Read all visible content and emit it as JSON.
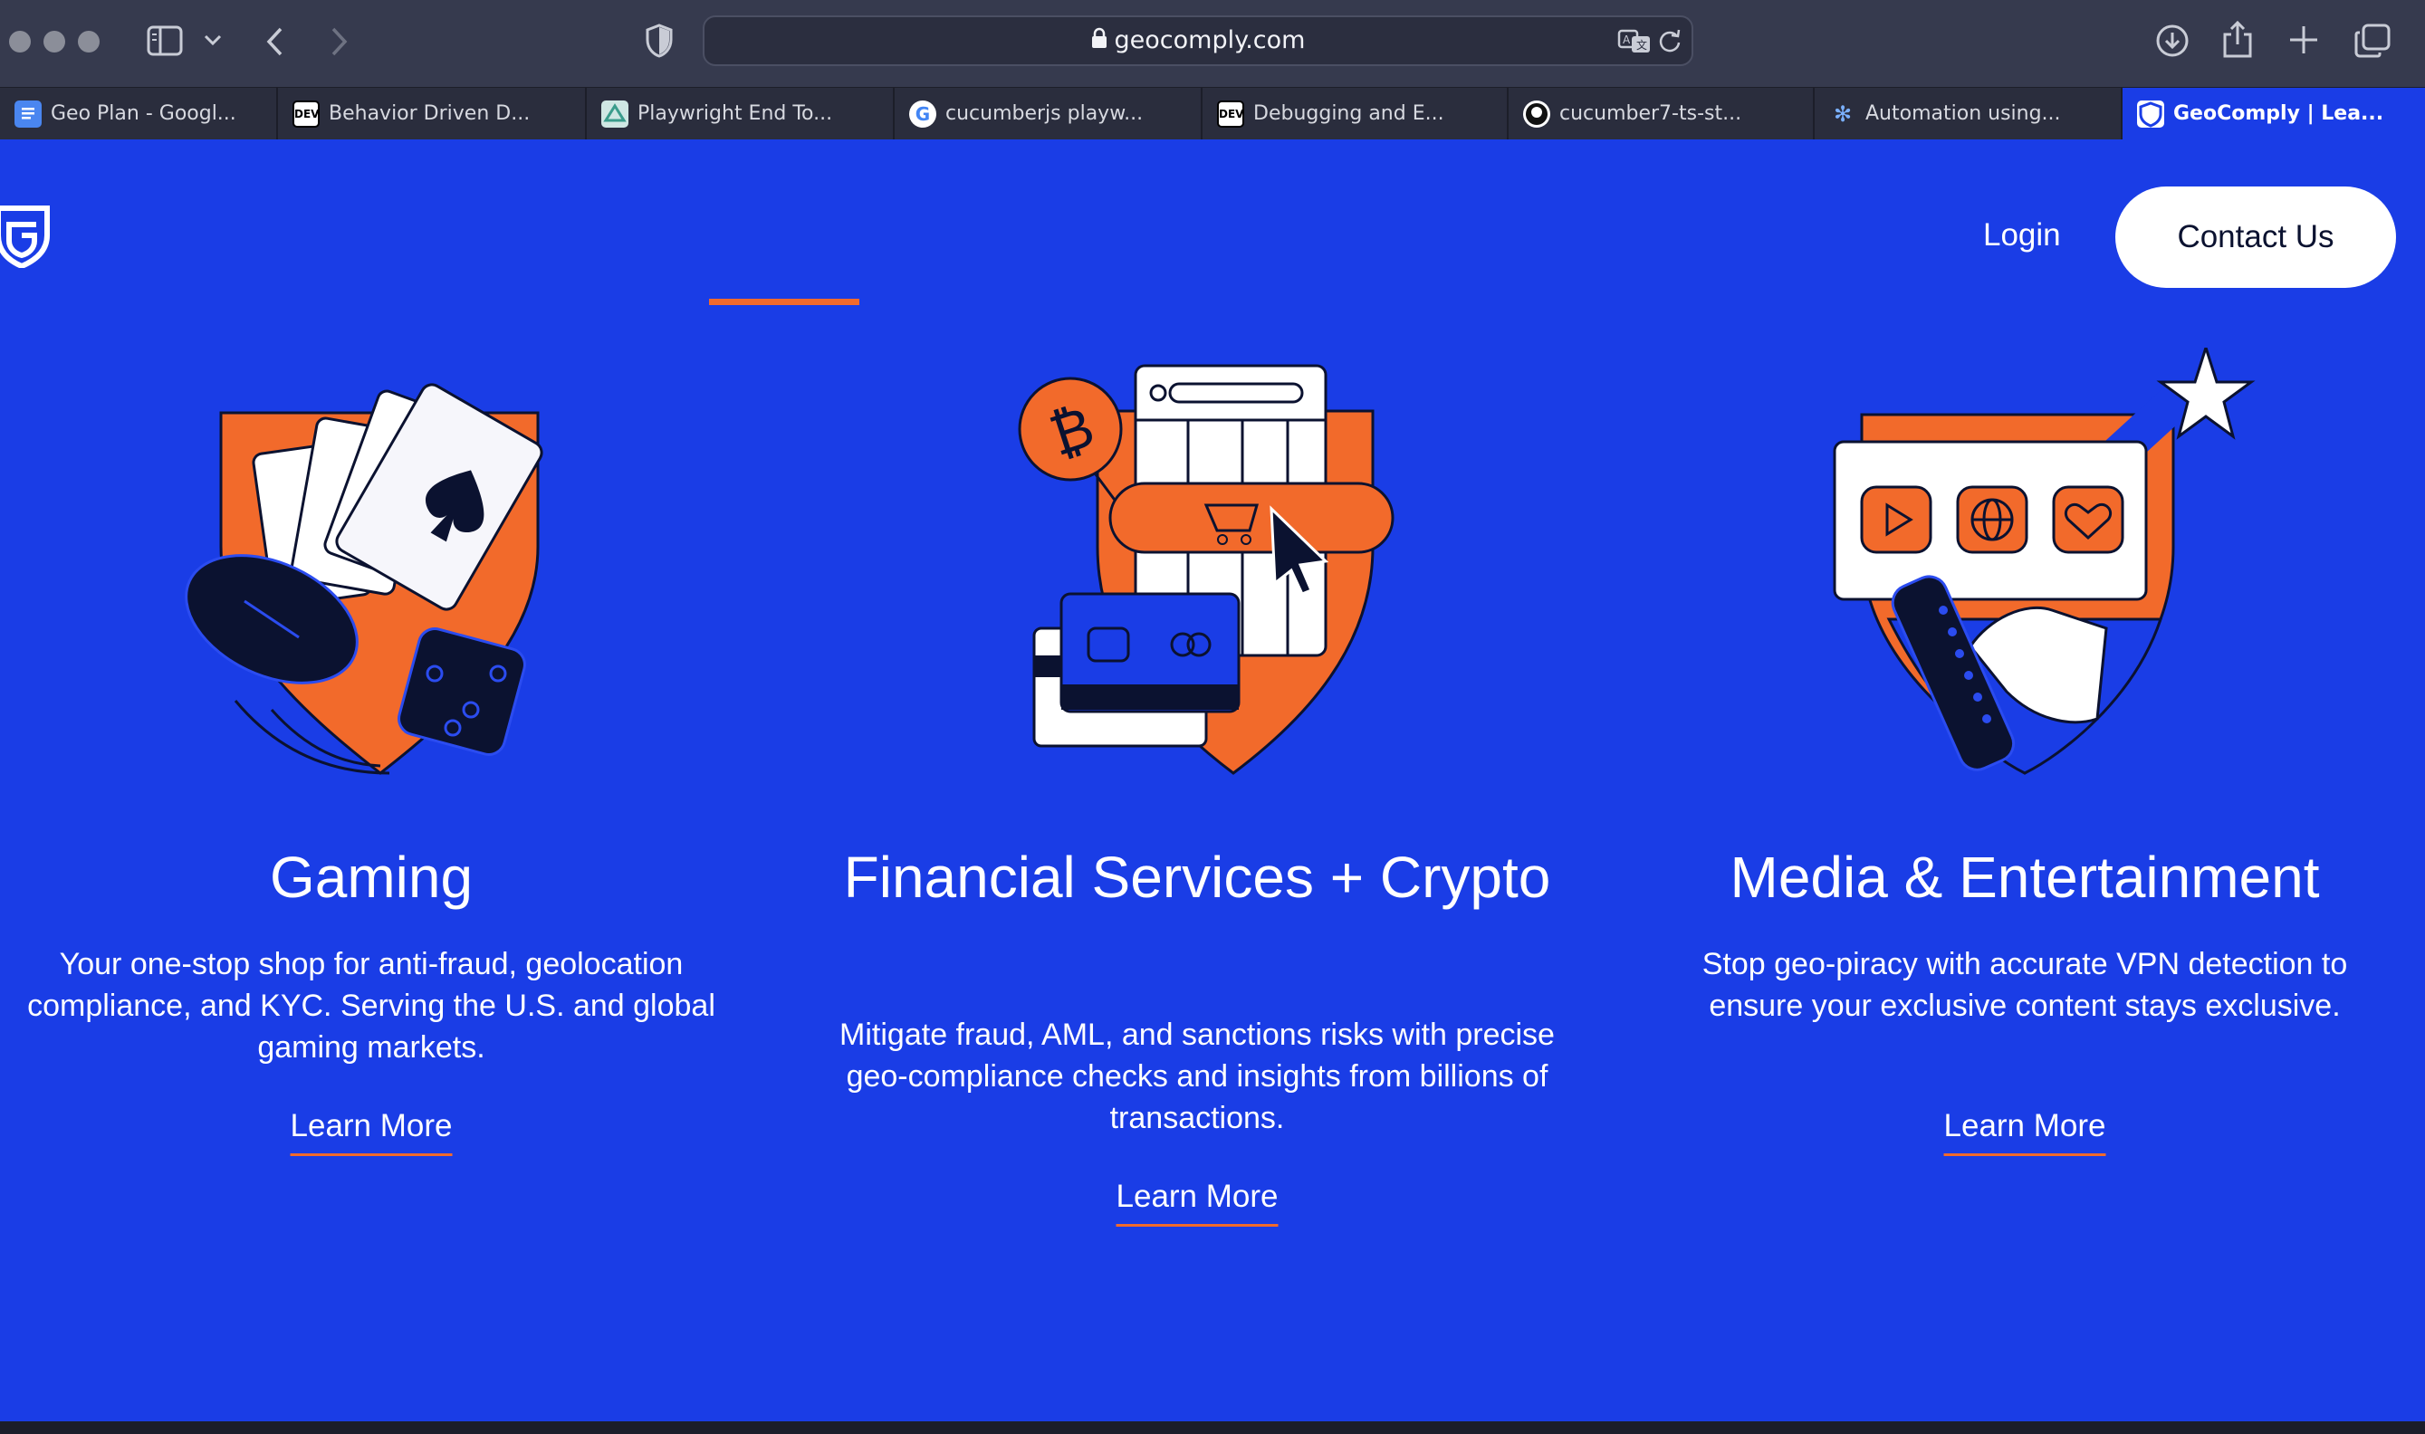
{
  "browser": {
    "url": "geocomply.com",
    "tabs": [
      {
        "label": "Geo Plan - Googl...",
        "icon": "google-docs-icon",
        "active": false
      },
      {
        "label": "Behavior Driven D...",
        "icon": "dev-icon",
        "active": false
      },
      {
        "label": "Playwright End To...",
        "icon": "site-icon",
        "active": false
      },
      {
        "label": "cucumberjs playw...",
        "icon": "google-icon",
        "active": false
      },
      {
        "label": "Debugging and E...",
        "icon": "dev-icon",
        "active": false
      },
      {
        "label": "cucumber7-ts-st...",
        "icon": "github-icon",
        "active": false
      },
      {
        "label": "Automation using...",
        "icon": "sparkle-icon",
        "active": false
      },
      {
        "label": "GeoComply | Lea...",
        "icon": "geocomply-icon",
        "active": true
      }
    ]
  },
  "header": {
    "login_label": "Login",
    "contact_label": "Contact Us"
  },
  "columns": [
    {
      "title": "Gaming",
      "description": "Your one-stop shop for anti-fraud, geolocation compliance, and KYC. Serving the U.S. and global gaming markets.",
      "link": "Learn More"
    },
    {
      "title": "Financial Services + Crypto",
      "description": "Mitigate fraud, AML, and sanctions risks with precise geo-compliance checks and insights from billions of transactions.",
      "link": "Learn More"
    },
    {
      "title": "Media & Entertainment",
      "description": "Stop geo-piracy with accurate VPN detection to ensure your exclusive content stays exclusive.",
      "link": "Learn More"
    }
  ],
  "colors": {
    "page_bg": "#1a3de6",
    "accent": "#f26a2b",
    "navy": "#0b1230"
  }
}
